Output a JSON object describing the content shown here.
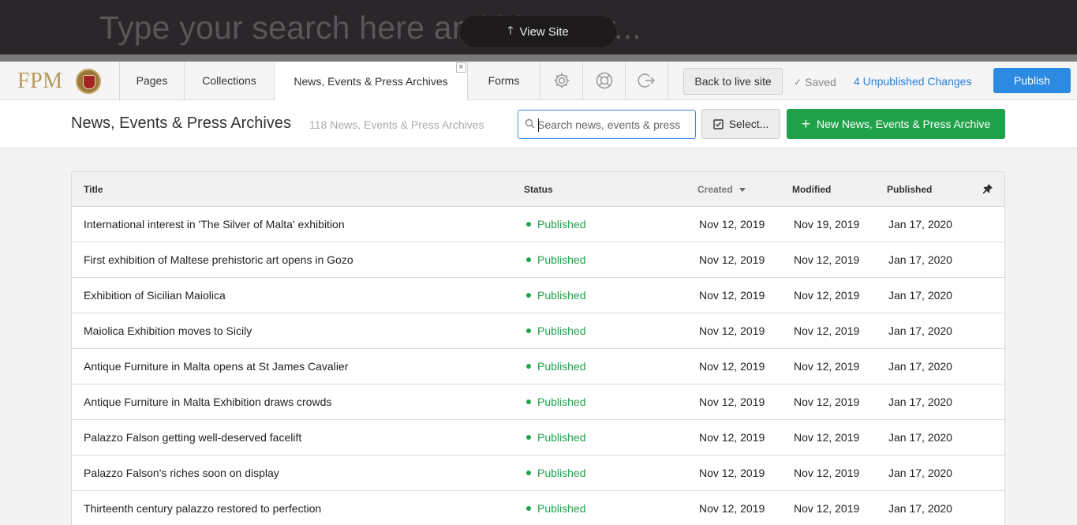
{
  "topbar": {
    "search_placeholder": "Type your search here and hit enter...",
    "view_site_label": "View Site"
  },
  "nav": {
    "logo_text": "FPM",
    "tabs": [
      {
        "label": "Pages"
      },
      {
        "label": "Collections"
      },
      {
        "label": "News, Events & Press Archives"
      },
      {
        "label": "Forms"
      }
    ],
    "close_glyph": "×",
    "icons": [
      "gear-icon",
      "help-ring-icon",
      "logout-icon"
    ],
    "back_label": "Back to live site",
    "saved_label": "Saved",
    "unpublished_label": "4 Unpublished Changes",
    "publish_label": "Publish"
  },
  "list_header": {
    "title": "News, Events & Press Archives",
    "count": "118 News, Events & Press Archives",
    "search_placeholder": "Search news, events & press",
    "select_label": "Select...",
    "new_label": "New News, Events & Press Archive"
  },
  "table": {
    "columns": {
      "title": "Title",
      "status": "Status",
      "created": "Created",
      "modified": "Modified",
      "published": "Published"
    },
    "rows": [
      {
        "title": "International interest in 'The Silver of Malta' exhibition",
        "status": "Published",
        "created": "Nov 12, 2019",
        "modified": "Nov 19, 2019",
        "published": "Jan 17, 2020"
      },
      {
        "title": "First exhibition of Maltese prehistoric art opens in Gozo",
        "status": "Published",
        "created": "Nov 12, 2019",
        "modified": "Nov 12, 2019",
        "published": "Jan 17, 2020"
      },
      {
        "title": "Exhibition of Sicilian Maiolica",
        "status": "Published",
        "created": "Nov 12, 2019",
        "modified": "Nov 12, 2019",
        "published": "Jan 17, 2020"
      },
      {
        "title": "Maiolica Exhibition moves to Sicily",
        "status": "Published",
        "created": "Nov 12, 2019",
        "modified": "Nov 12, 2019",
        "published": "Jan 17, 2020"
      },
      {
        "title": "Antique Furniture in Malta opens at St James Cavalier",
        "status": "Published",
        "created": "Nov 12, 2019",
        "modified": "Nov 12, 2019",
        "published": "Jan 17, 2020"
      },
      {
        "title": "Antique Furniture in Malta Exhibition draws crowds",
        "status": "Published",
        "created": "Nov 12, 2019",
        "modified": "Nov 12, 2019",
        "published": "Jan 17, 2020"
      },
      {
        "title": "Palazzo Falson getting well-deserved facelift",
        "status": "Published",
        "created": "Nov 12, 2019",
        "modified": "Nov 12, 2019",
        "published": "Jan 17, 2020"
      },
      {
        "title": "Palazzo Falson's riches soon on display",
        "status": "Published",
        "created": "Nov 12, 2019",
        "modified": "Nov 12, 2019",
        "published": "Jan 17, 2020"
      },
      {
        "title": "Thirteenth century palazzo restored to perfection",
        "status": "Published",
        "created": "Nov 12, 2019",
        "modified": "Nov 12, 2019",
        "published": "Jan 17, 2020"
      }
    ]
  },
  "colors": {
    "accent_blue": "#2d8ae3",
    "success_green": "#1fa24a",
    "topbar_bg": "#2b2629"
  }
}
